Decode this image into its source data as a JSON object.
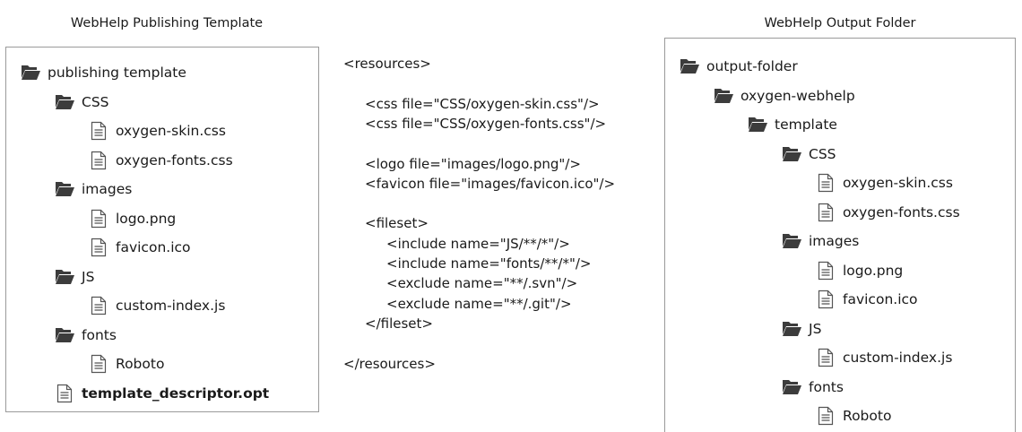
{
  "left_title": "WebHelp Publishing Template",
  "right_title": "WebHelp Output Folder",
  "left_tree": [
    {
      "label": "publishing template",
      "type": "folder",
      "depth": 0,
      "bold": false
    },
    {
      "label": "CSS",
      "type": "folder",
      "depth": 1,
      "bold": false
    },
    {
      "label": "oxygen-skin.css",
      "type": "file",
      "depth": 2,
      "bold": false
    },
    {
      "label": "oxygen-fonts.css",
      "type": "file",
      "depth": 2,
      "bold": false
    },
    {
      "label": "images",
      "type": "folder",
      "depth": 1,
      "bold": false
    },
    {
      "label": "logo.png",
      "type": "file",
      "depth": 2,
      "bold": false
    },
    {
      "label": "favicon.ico",
      "type": "file",
      "depth": 2,
      "bold": false
    },
    {
      "label": "JS",
      "type": "folder",
      "depth": 1,
      "bold": false
    },
    {
      "label": "custom-index.js",
      "type": "file",
      "depth": 2,
      "bold": false
    },
    {
      "label": "fonts",
      "type": "folder",
      "depth": 1,
      "bold": false
    },
    {
      "label": "Roboto",
      "type": "file",
      "depth": 2,
      "bold": false
    },
    {
      "label": "template_descriptor.opt",
      "type": "file",
      "depth": 1,
      "bold": true
    }
  ],
  "right_tree": [
    {
      "label": "output-folder",
      "type": "folder",
      "depth": 0
    },
    {
      "label": "oxygen-webhelp",
      "type": "folder",
      "depth": 1
    },
    {
      "label": "template",
      "type": "folder",
      "depth": 2
    },
    {
      "label": "CSS",
      "type": "folder",
      "depth": 3
    },
    {
      "label": "oxygen-skin.css",
      "type": "file",
      "depth": 4
    },
    {
      "label": "oxygen-fonts.css",
      "type": "file",
      "depth": 4
    },
    {
      "label": "images",
      "type": "folder",
      "depth": 3
    },
    {
      "label": "logo.png",
      "type": "file",
      "depth": 4
    },
    {
      "label": "favicon.ico",
      "type": "file",
      "depth": 4
    },
    {
      "label": "JS",
      "type": "folder",
      "depth": 3
    },
    {
      "label": "custom-index.js",
      "type": "file",
      "depth": 4
    },
    {
      "label": "fonts",
      "type": "folder",
      "depth": 3
    },
    {
      "label": "Roboto",
      "type": "file",
      "depth": 4
    }
  ],
  "xml_lines": [
    {
      "text": "<resources>",
      "indent": 0,
      "line": 0
    },
    {
      "text": "<css file=\"CSS/oxygen-skin.css\"/>",
      "indent": 1,
      "line": 2
    },
    {
      "text": "<css file=\"CSS/oxygen-fonts.css\"/>",
      "indent": 1,
      "line": 3
    },
    {
      "text": "<logo file=\"images/logo.png\"/>",
      "indent": 1,
      "line": 5
    },
    {
      "text": "<favicon file=\"images/favicon.ico\"/>",
      "indent": 1,
      "line": 6
    },
    {
      "text": "<fileset>",
      "indent": 1,
      "line": 8
    },
    {
      "text": "<include name=\"JS/**/*\"/>",
      "indent": 2,
      "line": 9
    },
    {
      "text": "<include name=\"fonts/**/*\"/>",
      "indent": 2,
      "line": 10
    },
    {
      "text": "<exclude name=\"**/.svn\"/>",
      "indent": 2,
      "line": 11
    },
    {
      "text": "<exclude name=\"**/.git\"/>",
      "indent": 2,
      "line": 12
    },
    {
      "text": "</fileset>",
      "indent": 1,
      "line": 13
    },
    {
      "text": "</resources>",
      "indent": 0,
      "line": 15
    }
  ],
  "icons": {
    "folder": "folder-icon",
    "file": "file-icon"
  },
  "colors": {
    "folder": "#3c3c3c",
    "file_stroke": "#555555",
    "panel_border": "#9a9a9a"
  }
}
